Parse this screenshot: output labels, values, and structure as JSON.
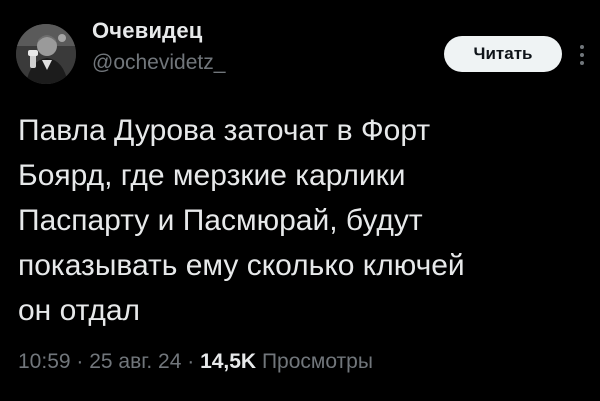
{
  "author": {
    "display_name": "Очевидец",
    "handle": "@ochevidetz_"
  },
  "actions": {
    "follow_label": "Читать",
    "more_icon": "more-vertical-icon"
  },
  "tweet": {
    "text": "Павла Дурова заточат в Форт\nБоярд, где мерзкие карлики\nПаспарту и Пасмюрай, будут\nпоказывать ему сколько ключей\nон отдал"
  },
  "meta": {
    "time": "10:59",
    "separator": " · ",
    "date": "25 авг. 24",
    "views_count": "14,5K",
    "views_label": "Просмотры"
  },
  "colors": {
    "background": "#000000",
    "text_primary": "#e7e9ea",
    "text_secondary": "#71767b",
    "button_bg": "#eff3f4",
    "button_text": "#0f1419"
  }
}
